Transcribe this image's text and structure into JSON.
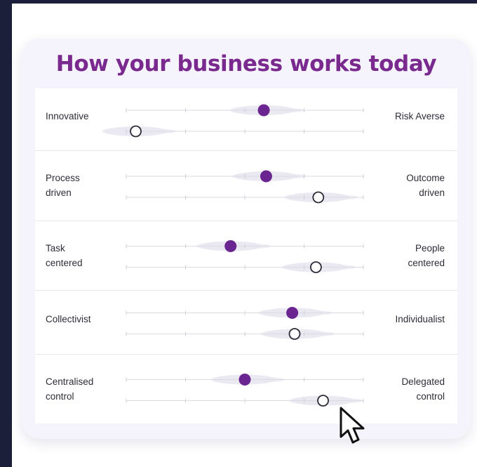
{
  "title": "How your business works today",
  "colors": {
    "title": "#7a2a8f",
    "filled_marker": "#6a2590",
    "hollow_marker": "#2c2c38",
    "distribution": "#e9e7f0"
  },
  "rows": [
    {
      "left": "Innovative",
      "right": "Risk Averse",
      "filled": 0.58,
      "hollow": 0.04
    },
    {
      "left": "Process\ndriven",
      "right": "Outcome\ndriven",
      "filled": 0.59,
      "hollow": 0.81
    },
    {
      "left": "Task\ncentered",
      "right": "People\ncentered",
      "filled": 0.44,
      "hollow": 0.8
    },
    {
      "left": "Collectivist",
      "right": "Individualist",
      "filled": 0.7,
      "hollow": 0.71
    },
    {
      "left": "Centralised\ncontrol",
      "right": "Delegated\ncontrol",
      "filled": 0.5,
      "hollow": 0.83
    }
  ],
  "icons": {
    "cursor": "pointer-cursor-icon"
  }
}
